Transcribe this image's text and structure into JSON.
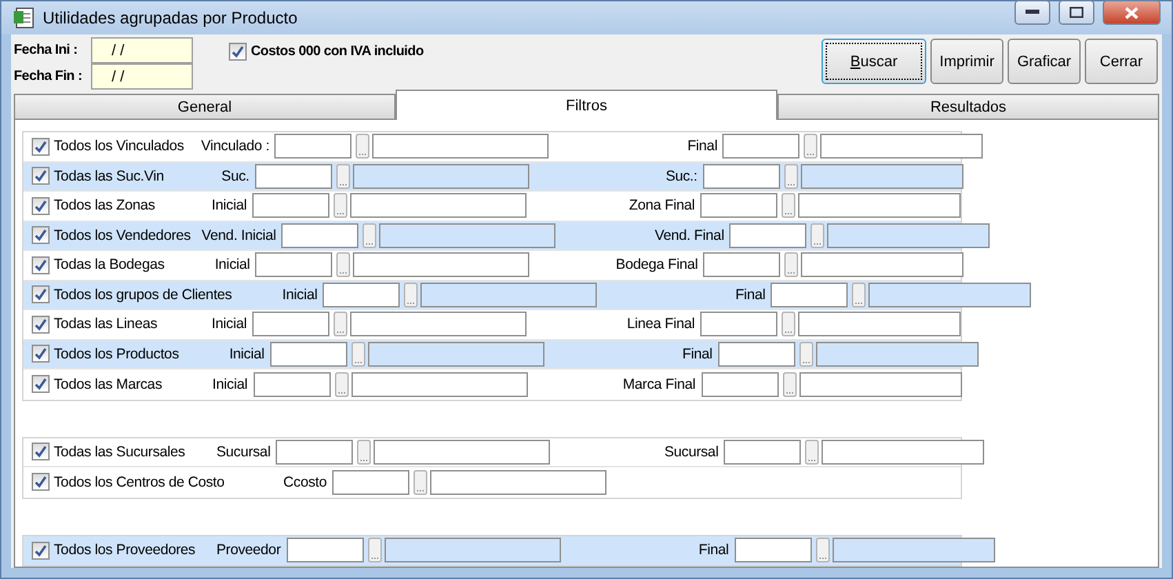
{
  "window": {
    "title": "Utilidades agrupadas por Producto"
  },
  "dates": [
    {
      "label": "Fecha Ini :",
      "value": "/ /"
    },
    {
      "label": "Fecha Fin :",
      "value": "/ /"
    }
  ],
  "iva_option": {
    "label": "Costos 000 con IVA incluido",
    "checked": true
  },
  "buttons": [
    {
      "label": "Buscar",
      "focused": true,
      "mnemonic": true
    },
    {
      "label": "Imprimir",
      "focused": false,
      "mnemonic": false
    },
    {
      "label": "Graficar",
      "focused": false,
      "mnemonic": false
    },
    {
      "label": "Cerrar",
      "focused": false,
      "mnemonic": false
    }
  ],
  "tabs": [
    {
      "label": "General",
      "selected": false
    },
    {
      "label": "Filtros",
      "selected": true
    },
    {
      "label": "Resultados",
      "selected": false
    }
  ],
  "filter_groups": [
    {
      "bordered": true,
      "rows": [
        {
          "label": "Todos los Vinculados",
          "checked": true,
          "highlighted": false,
          "start": {
            "label": "Vinculado :"
          },
          "end": {
            "label": "Final"
          }
        },
        {
          "label": "Todas las Suc.Vin",
          "checked": true,
          "highlighted": true,
          "start": {
            "label": "Suc."
          },
          "end": {
            "label": "Suc.:"
          }
        },
        {
          "label": "Todos las Zonas",
          "checked": true,
          "highlighted": false,
          "start": {
            "label": "Inicial"
          },
          "end": {
            "label": "Zona Final"
          }
        },
        {
          "label": "Todos los Vendedores",
          "checked": true,
          "highlighted": true,
          "start": {
            "label": "Vend. Inicial"
          },
          "end": {
            "label": "Vend. Final"
          }
        },
        {
          "label": "Todas la Bodegas",
          "checked": true,
          "highlighted": false,
          "start": {
            "label": "Inicial"
          },
          "end": {
            "label": "Bodega Final"
          }
        },
        {
          "label": "Todos los grupos de Clientes",
          "checked": true,
          "highlighted": true,
          "start": {
            "label": "Inicial"
          },
          "end": {
            "label": "Final"
          }
        },
        {
          "label": "Todas las Lineas",
          "checked": true,
          "highlighted": false,
          "start": {
            "label": "Inicial"
          },
          "end": {
            "label": "Linea Final"
          }
        },
        {
          "label": "Todos los Productos",
          "checked": true,
          "highlighted": true,
          "start": {
            "label": "Inicial"
          },
          "end": {
            "label": "Final"
          }
        },
        {
          "label": "Todos las Marcas",
          "checked": true,
          "highlighted": false,
          "start": {
            "label": "Inicial"
          },
          "end": {
            "label": "Marca Final"
          }
        }
      ]
    },
    {
      "bordered": true,
      "rows": [
        {
          "label": "Todas las Sucursales",
          "checked": true,
          "highlighted": false,
          "start": {
            "label": "Sucursal"
          },
          "end": {
            "label": "Sucursal"
          }
        },
        {
          "label": "Todos los Centros de Costo",
          "checked": true,
          "highlighted": false,
          "start": {
            "label": "Ccosto"
          }
        }
      ]
    },
    {
      "bordered": true,
      "rows": [
        {
          "label": "Todos los Proveedores",
          "checked": true,
          "highlighted": true,
          "start": {
            "label": "Proveedor"
          },
          "end": {
            "label": "Final"
          }
        }
      ]
    }
  ]
}
